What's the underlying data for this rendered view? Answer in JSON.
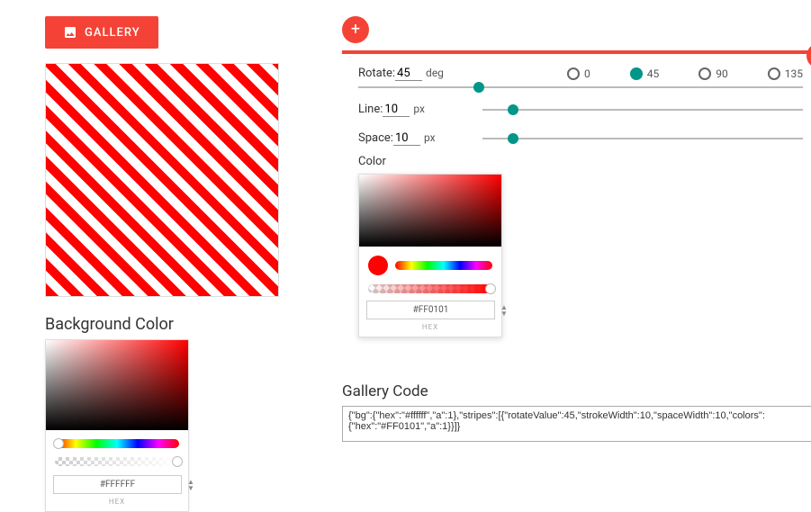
{
  "header": {
    "gallery_button": "GALLERY"
  },
  "preview": {
    "bg_color": "#ffffff",
    "stripe_color": "#FF0101",
    "rotate": 45,
    "line": 10,
    "space": 10
  },
  "bg_picker": {
    "label": "Background Color",
    "hue_base": "#ff0000",
    "hex_value": "#FFFFFF",
    "hex_label": "HEX"
  },
  "panel": {
    "rotate_label": "Rotate:",
    "rotate_value": "45",
    "rotate_unit": "deg",
    "rotate_options": [
      {
        "value": "0",
        "selected": false
      },
      {
        "value": "45",
        "selected": true
      },
      {
        "value": "90",
        "selected": false
      },
      {
        "value": "135",
        "selected": false
      }
    ],
    "line_label": "Line:",
    "line_value": "10",
    "line_unit": "px",
    "space_label": "Space:",
    "space_value": "10",
    "space_unit": "px",
    "color_label": "Color",
    "color_picker": {
      "hue_base": "#ff0000",
      "swatch": "#FF0101",
      "hex_value": "#FF0101",
      "hex_label": "HEX"
    }
  },
  "code": {
    "label": "Gallery Code",
    "value": "{\"bg\":{\"hex\":\"#ffffff\",\"a\":1},\"stripes\":[{\"rotateValue\":45,\"strokeWidth\":10,\"spaceWidth\":10,\"colors\":{\"hex\":\"#FF0101\",\"a\":1}}]}"
  },
  "colors": {
    "accent": "#f44336",
    "teal": "#009688"
  }
}
